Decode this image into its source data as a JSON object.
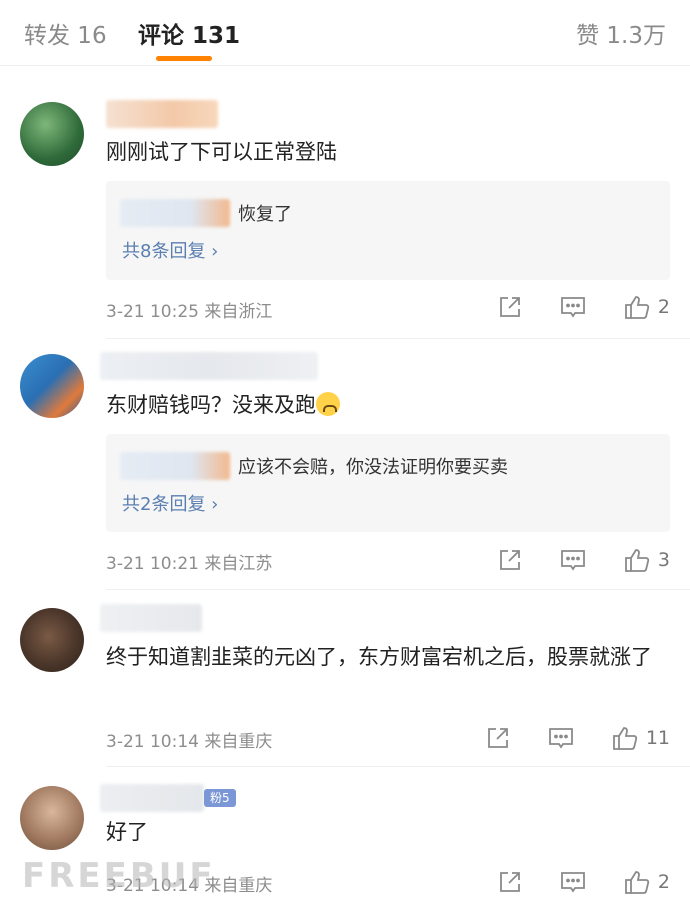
{
  "tabs": {
    "repost": "转发 16",
    "comments": "评论 131",
    "likes": "赞 1.3万"
  },
  "colors": {
    "accent": "#ff8200",
    "link": "#5a7fb0"
  },
  "icons": {
    "share": "share-icon",
    "reply": "comment-icon",
    "like": "thumbs-up-icon"
  },
  "comments": [
    {
      "text": "刚刚试了下可以正常登陆",
      "reply_text": "恢复了",
      "reply_more": "共8条回复 ›",
      "meta": "3-21 10:25  来自浙江",
      "likes": "2"
    },
    {
      "text": "东财赔钱吗？没来及跑",
      "reply_text": "应该不会赔，你没法证明你要买卖",
      "reply_more": "共2条回复 ›",
      "meta": "3-21 10:21  来自江苏",
      "likes": "3"
    },
    {
      "text": "终于知道割韭菜的元凶了，东方财富宕机之后，股票就涨了",
      "meta": "3-21 10:14  来自重庆",
      "likes": "11"
    },
    {
      "text": "好了",
      "fan_badge": "粉5",
      "meta": "3-21 10:14  来自重庆",
      "likes": "2"
    }
  ],
  "watermark": "FREEBUF"
}
